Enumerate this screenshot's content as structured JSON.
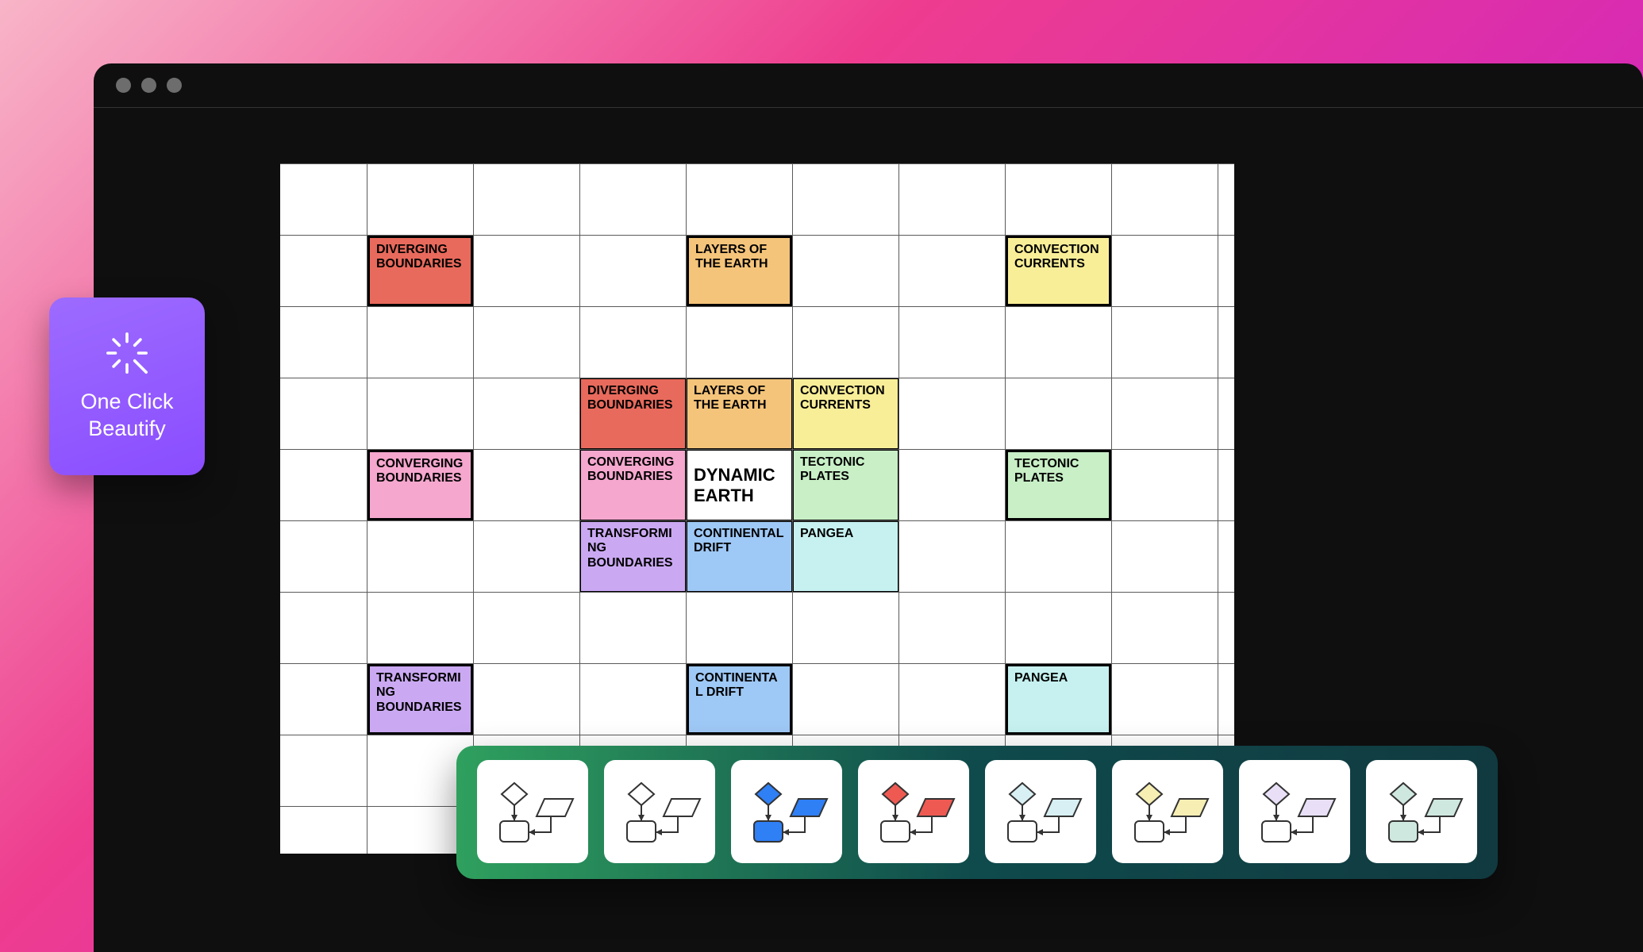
{
  "beautify": {
    "line1": "One Click",
    "line2": "Beautify"
  },
  "colors": {
    "red": "#e86a5c",
    "orange": "#f4c47a",
    "yellow": "#f9ee98",
    "pink": "#f5a7ce",
    "green": "#c8efc6",
    "purple": "#caa9f2",
    "blue": "#9ec8f5",
    "cyan": "#c6f1f0",
    "white": "#ffffff"
  },
  "cells": [
    {
      "label": "DIVERGING BOUNDARIES",
      "color": "red",
      "col": 1,
      "row": 1,
      "outer": true
    },
    {
      "label": "LAYERS OF THE EARTH",
      "color": "orange",
      "col": 4,
      "row": 1,
      "outer": true
    },
    {
      "label": "CONVECTION CURRENTS",
      "color": "yellow",
      "col": 7,
      "row": 1,
      "outer": true
    },
    {
      "label": "DIVERGING BOUNDARIES",
      "color": "red",
      "col": 3,
      "row": 3,
      "outer": false
    },
    {
      "label": "LAYERS OF THE EARTH",
      "color": "orange",
      "col": 4,
      "row": 3,
      "outer": false
    },
    {
      "label": "CONVECTION CURRENTS",
      "color": "yellow",
      "col": 5,
      "row": 3,
      "outer": false
    },
    {
      "label": "CONVERGING BOUNDARIES",
      "color": "pink",
      "col": 1,
      "row": 4,
      "outer": true
    },
    {
      "label": "CONVERGING BOUNDARIES",
      "color": "pink",
      "col": 3,
      "row": 4,
      "outer": false
    },
    {
      "label": "DYNAMIC EARTH",
      "color": "white",
      "col": 4,
      "row": 4,
      "outer": false,
      "center": true
    },
    {
      "label": "TECTONIC PLATES",
      "color": "green",
      "col": 5,
      "row": 4,
      "outer": false
    },
    {
      "label": "TECTONIC PLATES",
      "color": "green",
      "col": 7,
      "row": 4,
      "outer": true
    },
    {
      "label": "TRANSFORMING BOUNDARIES",
      "color": "purple",
      "col": 3,
      "row": 5,
      "outer": false
    },
    {
      "label": "CONTINENTAL DRIFT",
      "color": "blue",
      "col": 4,
      "row": 5,
      "outer": false
    },
    {
      "label": "PANGEA",
      "color": "cyan",
      "col": 5,
      "row": 5,
      "outer": false
    },
    {
      "label": "TRANSFORMING BOUNDARIES",
      "color": "purple",
      "col": 1,
      "row": 7,
      "outer": true
    },
    {
      "label": "CONTINENTAL DRIFT",
      "color": "blue",
      "col": 4,
      "row": 7,
      "outer": true
    },
    {
      "label": "PANGEA",
      "color": "cyan",
      "col": 7,
      "row": 7,
      "outer": true
    }
  ],
  "themes": [
    {
      "diamond": "#ffffff",
      "para": "#ffffff",
      "rect": "#ffffff"
    },
    {
      "diamond": "#ffffff",
      "para": "#ffffff",
      "rect": "#ffffff"
    },
    {
      "diamond": "#2f7ff5",
      "para": "#2f7ff5",
      "rect": "#2f7ff5"
    },
    {
      "diamond": "#ee5a52",
      "para": "#ee5a52",
      "rect": "#ffffff"
    },
    {
      "diamond": "#d8f0f3",
      "para": "#d8f0f3",
      "rect": "#ffffff"
    },
    {
      "diamond": "#f6eeb3",
      "para": "#f6eeb3",
      "rect": "#ffffff"
    },
    {
      "diamond": "#e9e0f8",
      "para": "#e9e0f8",
      "rect": "#ffffff"
    },
    {
      "diamond": "#cfe8df",
      "para": "#cfe8df",
      "rect": "#cfe8df"
    }
  ]
}
